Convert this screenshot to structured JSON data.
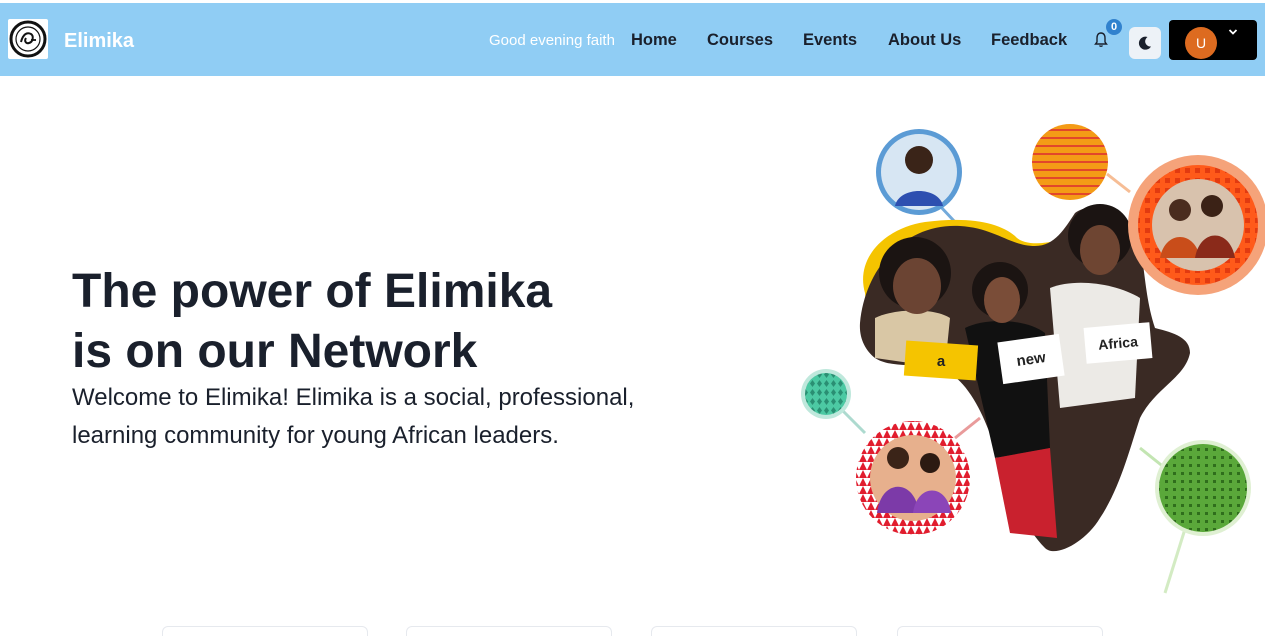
{
  "navbar": {
    "brand": "Elimika",
    "greeting": "Good evening faith",
    "links": [
      "Home",
      "Courses",
      "Events",
      "About Us",
      "Feedback"
    ],
    "notification_count": "0",
    "avatar_initial": "U",
    "background_color": "#90cdf4",
    "accent_color": "#dd6b20"
  },
  "hero": {
    "title_line1": "The power of Elimika",
    "title_line2": "is on our Network",
    "subtitle": "Welcome to Elimika! Elimika is a social, professional, learning community for young African leaders."
  },
  "illustration": {
    "signs": [
      "a",
      "new",
      "Africa"
    ]
  },
  "icons": {
    "logo": "sigma-logo-icon",
    "bell": "bell-icon",
    "theme": "moon-icon",
    "caret": "chevron-down-icon"
  }
}
